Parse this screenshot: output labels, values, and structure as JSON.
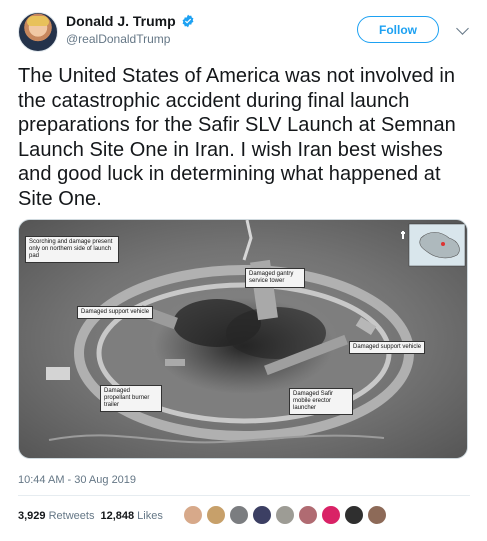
{
  "account": {
    "display_name": "Donald J. Trump",
    "handle": "@realDonaldTrump",
    "verified": true
  },
  "actions": {
    "follow_label": "Follow"
  },
  "tweet": {
    "text": "The United States of America was not involved in the catastrophic accident during final launch preparations for the Safir SLV Launch at Semnan Launch Site One in Iran. I wish Iran best wishes and good luck in determining what happened at Site One.",
    "timestamp": "10:44 AM - 30 Aug 2019"
  },
  "media": {
    "labels": {
      "scorching": "Scorching and damage present only on northern side of launch pad",
      "gantry": "Damaged gantry service tower",
      "support_left": "Damaged support vehicle",
      "support_right": "Damaged support vehicle",
      "propellant": "Damaged propellant burner trailer",
      "safir": "Damaged Safir mobile erector launcher"
    }
  },
  "stats": {
    "retweets_count": "3,929",
    "retweets_label": "Retweets",
    "likes_count": "12,848",
    "likes_label": "Likes"
  },
  "colors": {
    "accent": "#1da1f2",
    "text": "#14171a",
    "muted": "#657786"
  },
  "liker_avatars": [
    "#d7a98a",
    "#c7a06a",
    "#7b7d80",
    "#3c3f63",
    "#9d9c95",
    "#b06b72",
    "#d92266",
    "#2f2f2f",
    "#8d6a58"
  ]
}
